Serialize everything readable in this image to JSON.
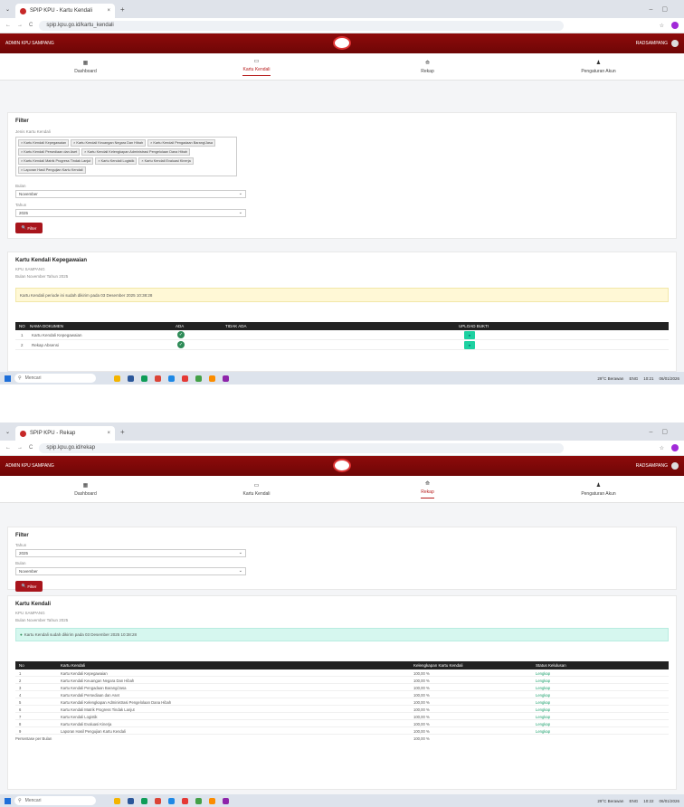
{
  "screens": [
    {
      "tab_title": "SPIP KPU - Kartu Kendali",
      "url": "spip.kpu.go.id/kartu_kendali",
      "header_left": "ADMIN KPU SAMPANG",
      "header_user": "RADSAMPANG",
      "nav": [
        "Dashboard",
        "Kartu Kendali",
        "Rekap",
        "Pengaturan Akun"
      ],
      "active_nav": 1
    },
    {
      "tab_title": "SPIP KPU - Rekap",
      "url": "spip.kpu.go.id/rekap",
      "header_left": "ADMIN KPU SAMPANG",
      "header_user": "RADSAMPANG",
      "nav": [
        "Dashboard",
        "Kartu Kendali",
        "Rekap",
        "Pengaturan Akun"
      ],
      "active_nav": 2
    }
  ],
  "kk": {
    "filter_title": "Filter",
    "jenis_label": "Jenis Kartu Kendali",
    "tags": [
      "× Kartu Kendali Kepegawaian",
      "× Kartu Kendali Keuangan Negara Dan Hibah",
      "× Kartu Kendali Pengadaan Barang/Jasa",
      "× Kartu Kendali Persediaan dan Aset",
      "× Kartu Kendali Kelengkapan Administrasi Pengelolaan Dana Hibah",
      "× Kartu Kendali Matrik Progress Tindak Lanjut",
      "× Kartu Kendali Logistik",
      "× Kartu Kendali Evaluasi Kinerja",
      "× Laporan Hasil Pengujian Kartu Kendali"
    ],
    "bulan_label": "Bulan",
    "bulan_value": "November",
    "tahun_label": "Tahun",
    "tahun_value": "2025",
    "filter_btn": "Filter",
    "section_title": "Kartu Kendali Kepegawaian",
    "org": "KPU SAMPANG",
    "period": "Bulan November Tahun 2025",
    "alert": "Kartu Kendali periode ini sudah dikirim pada 03 Desember 2025 10:38:28",
    "cols": [
      "NO",
      "NAMA DOKUMEN",
      "ADA",
      "TIDAK ADA",
      "UPLOAD BUKTI"
    ],
    "rows": [
      {
        "no": "1",
        "name": "Kartu Kendali Kepegawaian"
      },
      {
        "no": "2",
        "name": "Rekap Absensi"
      }
    ]
  },
  "rekap": {
    "filter_title": "Filter",
    "tahun_label": "Tahun",
    "tahun_value": "2025",
    "bulan_label": "Bulan",
    "bulan_value": "November",
    "filter_btn": "Filter",
    "section_title": "Kartu Kendali",
    "org": "KPU SAMPANG",
    "period": "Bulan November Tahun 2025",
    "alert": "Kartu Kendali sudah dikirim pada 03 Desember 2025 10:38:28",
    "cols": [
      "No",
      "Kartu Kendali",
      "Kelengkapan Kartu Kendali",
      "Status Kelulusan"
    ],
    "rows": [
      {
        "no": "1",
        "name": "Kartu Kendali Kepegawaian",
        "pct": "100,00 %",
        "status": "Lengkap"
      },
      {
        "no": "2",
        "name": "Kartu Kendali Keuangan Negara Dan Hibah",
        "pct": "100,00 %",
        "status": "Lengkap"
      },
      {
        "no": "3",
        "name": "Kartu Kendali Pengadaan Barang/Jasa",
        "pct": "100,00 %",
        "status": "Lengkap"
      },
      {
        "no": "4",
        "name": "Kartu Kendali Persediaan dan Aset",
        "pct": "100,00 %",
        "status": "Lengkap"
      },
      {
        "no": "5",
        "name": "Kartu Kendali Kelengkapan Administrasi Pengelolaan Dana Hibah",
        "pct": "100,00 %",
        "status": "Lengkap"
      },
      {
        "no": "6",
        "name": "Kartu Kendali Matrik Progress Tindak Lanjut",
        "pct": "100,00 %",
        "status": "Lengkap"
      },
      {
        "no": "7",
        "name": "Kartu Kendali Logistik",
        "pct": "100,00 %",
        "status": "Lengkap"
      },
      {
        "no": "8",
        "name": "Kartu Kendali Evaluasi Kinerja",
        "pct": "100,00 %",
        "status": "Lengkap"
      },
      {
        "no": "9",
        "name": "Laporan Hasil Pengujian Kartu Kendali",
        "pct": "100,00 %",
        "status": "Lengkap"
      }
    ],
    "total_label": "Persentase per Bulan",
    "total_pct": "100,00 %"
  },
  "taskbar": {
    "search": "Mencari",
    "weather": "29°C Berawan",
    "lang": "ENG",
    "time1": "10:21",
    "time2": "10:22",
    "date": "06/01/2026"
  }
}
